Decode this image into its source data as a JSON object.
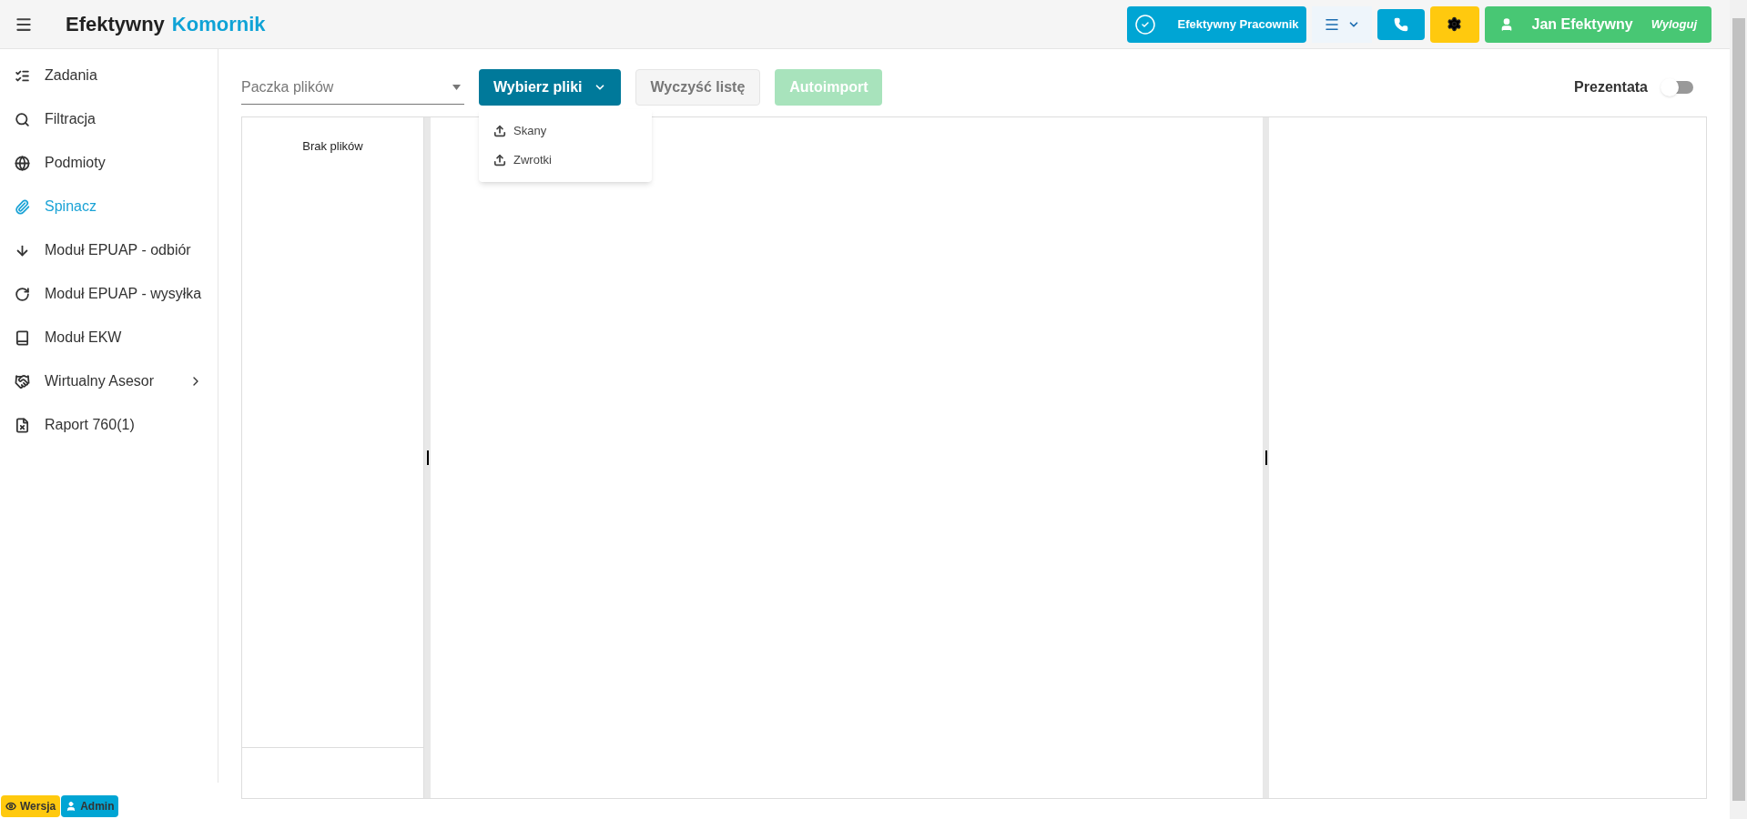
{
  "header": {
    "brand_1": "Efektywny",
    "brand_2": "Komornik",
    "app_button": "Efektywny Pracownik",
    "user_button": {
      "name": "Jan Efektywny",
      "logout": "Wyloguj"
    }
  },
  "sidebar": {
    "items": [
      {
        "label": "Zadania",
        "selected": false,
        "has_children": false
      },
      {
        "label": "Filtracja",
        "selected": false,
        "has_children": false
      },
      {
        "label": "Podmioty",
        "selected": false,
        "has_children": false
      },
      {
        "label": "Spinacz",
        "selected": true,
        "has_children": false
      },
      {
        "label": "Moduł EPUAP - odbiór",
        "selected": false,
        "has_children": false
      },
      {
        "label": "Moduł EPUAP - wysyłka",
        "selected": false,
        "has_children": false
      },
      {
        "label": "Moduł EKW",
        "selected": false,
        "has_children": false
      },
      {
        "label": "Wirtualny Asesor",
        "selected": false,
        "has_children": true
      },
      {
        "label": "Raport 760(1)",
        "selected": false,
        "has_children": false
      }
    ]
  },
  "toolbar": {
    "select": {
      "placeholder": "Paczka plików"
    },
    "buttons": [
      {
        "label": "Wybierz pliki",
        "kind": "primary",
        "expanded": true,
        "menu": [
          "Skany",
          "Zwrotki"
        ]
      },
      {
        "label": "Wyczyść listę",
        "kind": "light"
      },
      {
        "label": "Autoimport",
        "kind": "success-disabled"
      }
    ],
    "toggle": {
      "label": "Prezentata",
      "on": false
    }
  },
  "file_list": {
    "empty_text": "Brak plików"
  },
  "footer_badges": [
    {
      "label": "Wersja",
      "kind": "version"
    },
    {
      "label": "Admin",
      "kind": "user"
    }
  ]
}
